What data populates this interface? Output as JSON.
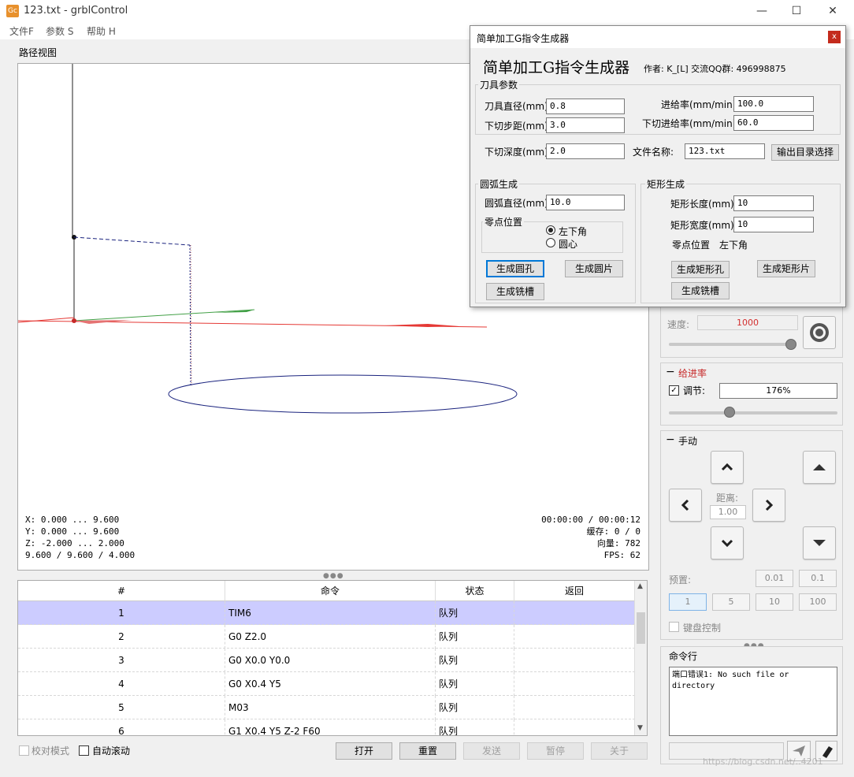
{
  "window": {
    "title": "123.txt - grblControl",
    "icon_text": "Gc",
    "minimize": "—",
    "maximize": "☐",
    "close": "✕"
  },
  "menu": [
    "文件F",
    "参数 S",
    "帮助 H"
  ],
  "path_view": {
    "label": "路径视图",
    "coords_left": [
      "X: 0.000 ... 9.600",
      "Y: 0.000 ... 9.600",
      "Z: -2.000 ... 2.000",
      "9.600 / 9.600 / 4.000"
    ],
    "coords_right": [
      "00:00:00 / 00:00:12",
      "缓存:   0 / 0",
      "向量: 782",
      "FPS: 62"
    ]
  },
  "table": {
    "headers": [
      "#",
      "命令",
      "状态",
      "返回"
    ],
    "rows": [
      {
        "num": "1",
        "cmd": "TIM6",
        "status": "队列",
        "ret": ""
      },
      {
        "num": "2",
        "cmd": "G0 Z2.0",
        "status": "队列",
        "ret": ""
      },
      {
        "num": "3",
        "cmd": "G0 X0.0 Y0.0",
        "status": "队列",
        "ret": ""
      },
      {
        "num": "4",
        "cmd": "G0 X0.4 Y5",
        "status": "队列",
        "ret": ""
      },
      {
        "num": "5",
        "cmd": "M03",
        "status": "队列",
        "ret": ""
      },
      {
        "num": "6",
        "cmd": "G1 X0.4 Y5 Z-2 F60",
        "status": "队列",
        "ret": ""
      }
    ]
  },
  "bottom": {
    "check_mode": "校对模式",
    "auto_scroll": "自动滚动",
    "buttons": [
      "打开",
      "重置",
      "发送",
      "暂停",
      "关于"
    ]
  },
  "spindle": {
    "speed_label": "速度:",
    "speed_value": "1000"
  },
  "feed": {
    "title": "给进率",
    "adjust_label": "调节:",
    "adjust_value": "176%"
  },
  "jog": {
    "title": "手动",
    "distance_label": "距离:",
    "distance_value": "1.00",
    "preset_label": "预置:",
    "presets": [
      "0.01",
      "0.1",
      "1",
      "5",
      "10",
      "100"
    ],
    "keyboard_label": "键盘控制"
  },
  "console": {
    "title": "命令行",
    "output": "端口错误1: No such file or directory",
    "input_value": ""
  },
  "watermark": "https://blog.csdn.net/..4201",
  "dialog": {
    "title": "简单加工G指令生成器",
    "heading": "简单加工G指令生成器",
    "author": "作者: K_[L]   交流QQ群: 496998875",
    "tool_group": "刀具参数",
    "tool_diameter_label": "刀具直径(mm)",
    "tool_diameter": "0.8",
    "step_down_label": "下切步距(mm)",
    "step_down": "3.0",
    "feed_label": "进给率(mm/min)",
    "feed": "100.0",
    "plunge_feed_label": "下切进给率(mm/min)",
    "plunge_feed": "60.0",
    "depth_label": "下切深度(mm)",
    "depth": "2.0",
    "filename_label": "文件名称:",
    "filename": "123.txt",
    "output_dir_button": "输出目录选择",
    "arc_group": "圆弧生成",
    "arc_diameter_label": "圆弧直径(mm)",
    "arc_diameter": "10.0",
    "zero_group": "零点位置",
    "radio_corner": "左下角",
    "radio_center": "圆心",
    "btn_circle_hole": "生成圆孔",
    "btn_circle_plate": "生成圆片",
    "btn_mill_slot": "生成铣槽",
    "rect_group": "矩形生成",
    "rect_length_label": "矩形长度(mm)",
    "rect_length": "10",
    "rect_width_label": "矩形宽度(mm)",
    "rect_width": "10",
    "rect_zero_label": "零点位置",
    "rect_zero_value": "左下角",
    "btn_rect_hole": "生成矩形孔",
    "btn_rect_plate": "生成矩形片",
    "btn_rect_slot": "生成铣槽",
    "close": "x"
  }
}
